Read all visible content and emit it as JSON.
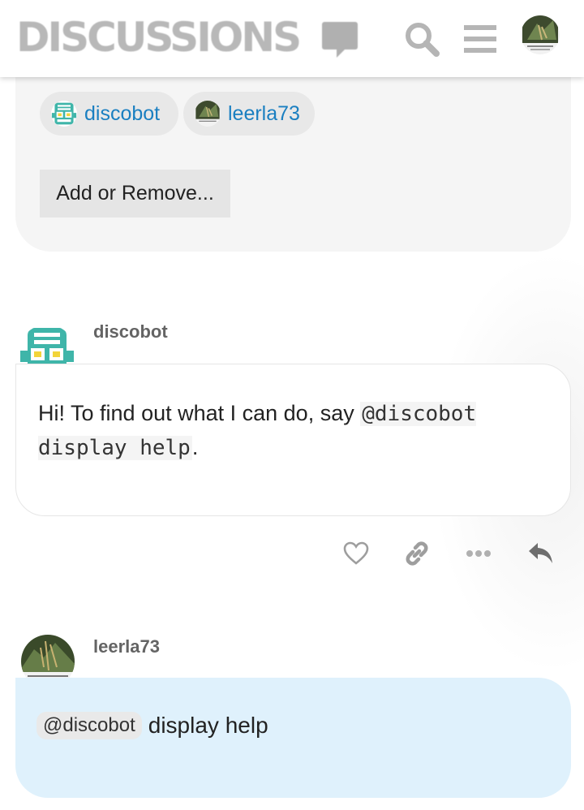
{
  "header": {
    "logo_text": "DISCUSSIONS",
    "icons": [
      "search-icon",
      "hamburger-menu-icon",
      "user-avatar"
    ]
  },
  "participants": {
    "chips": [
      {
        "name": "discobot",
        "avatar": "robot-avatar"
      },
      {
        "name": "leerla73",
        "avatar": "photo-avatar"
      }
    ],
    "add_remove_label": "Add or Remove..."
  },
  "posts": [
    {
      "author": "discobot",
      "text_before": "Hi! To find out what I can do, say ",
      "code": "@discobot display help",
      "text_after": ".",
      "actions": [
        "heart-icon",
        "link-icon",
        "more-icon",
        "reply-icon"
      ]
    },
    {
      "author": "leerla73",
      "mention": "@discobot",
      "text": "display help"
    }
  ],
  "colors": {
    "link": "#1a7fc1",
    "robot_teal": "#3fb5a9",
    "robot_yellow": "#f2d43a",
    "own_post_bg": "#dff1fc"
  }
}
